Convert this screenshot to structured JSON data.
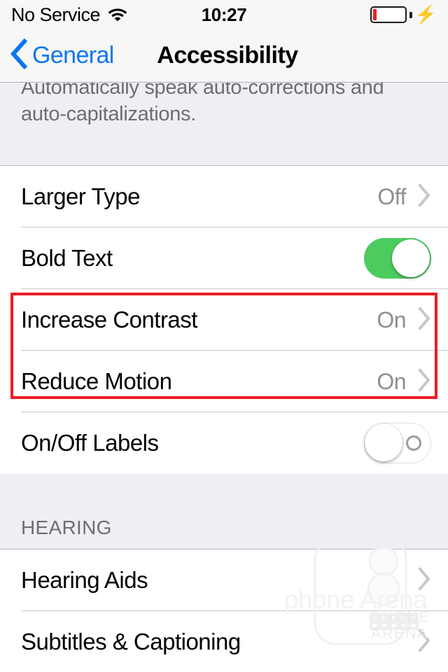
{
  "status_bar": {
    "carrier": "No Service",
    "wifi_icon": "wifi-icon",
    "time": "10:27",
    "battery_icon": "battery-icon",
    "charging_icon": "lightning-bolt-icon",
    "battery_level_percent": 5
  },
  "nav_bar": {
    "back_icon": "chevron-left-icon",
    "back_label": "General",
    "title": "Accessibility",
    "back_color": "#0b76ef"
  },
  "footer_note": {
    "text": "Automatically speak auto-corrections and auto-capitalizations."
  },
  "vision_section": {
    "rows": [
      {
        "label": "Larger Type",
        "value": "Off",
        "accessory": "chevron-right-icon",
        "type": "disclosure"
      },
      {
        "label": "Bold Text",
        "value": "On",
        "accessory": "switch",
        "type": "switch",
        "switch_state": "on"
      },
      {
        "label": "Increase Contrast",
        "value": "On",
        "accessory": "chevron-right-icon",
        "type": "disclosure"
      },
      {
        "label": "Reduce Motion",
        "value": "On",
        "accessory": "chevron-right-icon",
        "type": "disclosure"
      },
      {
        "label": "On/Off Labels",
        "value": "Off",
        "accessory": "switch",
        "type": "switch",
        "switch_state": "off"
      }
    ]
  },
  "hearing_section": {
    "header": "HEARING",
    "rows": [
      {
        "label": "Hearing Aids",
        "value": "",
        "accessory": "chevron-right-icon"
      },
      {
        "label": "Subtitles & Captioning",
        "value": "",
        "accessory": "chevron-right-icon"
      }
    ]
  },
  "annotation": {
    "color": "#ee1c25",
    "highlights": [
      "Increase Contrast",
      "Reduce Motion"
    ]
  },
  "watermark": {
    "text": "phone Arena",
    "logo_text_top": "PHONE",
    "logo_text_bottom": "ARENA"
  },
  "colors": {
    "switch_on": "#4ccb5f",
    "group_background": "#efeef3",
    "separator": "#c8c7cc",
    "value_text": "#8e8e93",
    "chrome_background": "#f7f7f7"
  }
}
